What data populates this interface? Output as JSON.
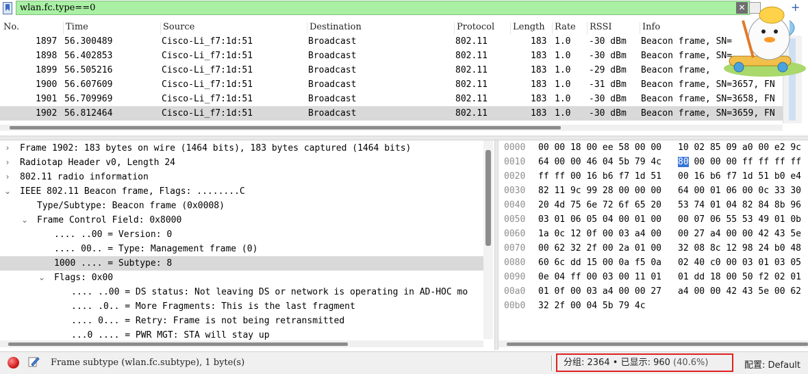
{
  "filter": {
    "value": "wlan.fc.type==0",
    "clear_icon": "✕"
  },
  "packet_list": {
    "columns": [
      "No.",
      "Time",
      "Source",
      "Destination",
      "Protocol",
      "Length",
      "Rate",
      "RSSI",
      "Info"
    ],
    "rows": [
      {
        "no": "1897",
        "time": "56.300489",
        "source": "Cisco-Li_f7:1d:51",
        "destination": "Broadcast",
        "protocol": "802.11",
        "length": "183",
        "rate": "1.0",
        "rssi": "-30 dBm",
        "info": "Beacon frame, SN="
      },
      {
        "no": "1898",
        "time": "56.402853",
        "source": "Cisco-Li_f7:1d:51",
        "destination": "Broadcast",
        "protocol": "802.11",
        "length": "183",
        "rate": "1.0",
        "rssi": "-30 dBm",
        "info": "Beacon frame, SN="
      },
      {
        "no": "1899",
        "time": "56.505216",
        "source": "Cisco-Li_f7:1d:51",
        "destination": "Broadcast",
        "protocol": "802.11",
        "length": "183",
        "rate": "1.0",
        "rssi": "-29 dBm",
        "info": "Beacon frame,"
      },
      {
        "no": "1900",
        "time": "56.607609",
        "source": "Cisco-Li_f7:1d:51",
        "destination": "Broadcast",
        "protocol": "802.11",
        "length": "183",
        "rate": "1.0",
        "rssi": "-31 dBm",
        "info": "Beacon frame, SN=3657, FN"
      },
      {
        "no": "1901",
        "time": "56.709969",
        "source": "Cisco-Li_f7:1d:51",
        "destination": "Broadcast",
        "protocol": "802.11",
        "length": "183",
        "rate": "1.0",
        "rssi": "-30 dBm",
        "info": "Beacon frame, SN=3658, FN"
      },
      {
        "no": "1902",
        "time": "56.812464",
        "source": "Cisco-Li_f7:1d:51",
        "destination": "Broadcast",
        "protocol": "802.11",
        "length": "183",
        "rate": "1.0",
        "rssi": "-30 dBm",
        "info": "Beacon frame, SN=3659, FN"
      }
    ],
    "selected_index": 5
  },
  "details": [
    {
      "text": "Frame 1902: 183 bytes on wire (1464 bits), 183 bytes captured (1464 bits)",
      "arrow": "›",
      "level": 0,
      "sel": false
    },
    {
      "text": "Radiotap Header v0, Length 24",
      "arrow": "›",
      "level": 0,
      "sel": false
    },
    {
      "text": "802.11 radio information",
      "arrow": "›",
      "level": 0,
      "sel": false
    },
    {
      "text": "IEEE 802.11 Beacon frame, Flags: ........C",
      "arrow": "⌄",
      "level": 0,
      "sel": false
    },
    {
      "text": "Type/Subtype: Beacon frame (0x0008)",
      "arrow": "",
      "level": 1,
      "sel": false
    },
    {
      "text": "Frame Control Field: 0x8000",
      "arrow": "⌄",
      "level": 1,
      "sel": false
    },
    {
      "text": ".... ..00 = Version: 0",
      "arrow": "",
      "level": 2,
      "sel": false
    },
    {
      "text": ".... 00.. = Type: Management frame (0)",
      "arrow": "",
      "level": 2,
      "sel": false
    },
    {
      "text": "1000 .... = Subtype: 8",
      "arrow": "",
      "level": 2,
      "sel": true
    },
    {
      "text": "Flags: 0x00",
      "arrow": "⌄",
      "level": 2,
      "sel": false
    },
    {
      "text": ".... ..00 = DS status: Not leaving DS or network is operating in AD-HOC mo",
      "arrow": "",
      "level": 3,
      "sel": false
    },
    {
      "text": ".... .0.. = More Fragments: This is the last fragment",
      "arrow": "",
      "level": 3,
      "sel": false
    },
    {
      "text": ".... 0... = Retry: Frame is not being retransmitted",
      "arrow": "",
      "level": 3,
      "sel": false
    },
    {
      "text": "...0 .... = PWR MGT: STA will stay up",
      "arrow": "",
      "level": 3,
      "sel": false
    }
  ],
  "hex": [
    {
      "offset": "0000",
      "b1": "00 00 18 00 ee 58 00 00",
      "b2": "10 02 85 09 a0 00 e2 9c"
    },
    {
      "offset": "0010",
      "b1": "64 00 00 46 04 5b 79 4c",
      "b2_hl": "80",
      "b2": " 00 00 00 ff ff ff ff"
    },
    {
      "offset": "0020",
      "b1": "ff ff 00 16 b6 f7 1d 51",
      "b2": "00 16 b6 f7 1d 51 b0 e4"
    },
    {
      "offset": "0030",
      "b1": "82 11 9c 99 28 00 00 00",
      "b2": "64 00 01 06 00 0c 33 30"
    },
    {
      "offset": "0040",
      "b1": "20 4d 75 6e 72 6f 65 20",
      "b2": "53 74 01 04 82 84 8b 96"
    },
    {
      "offset": "0050",
      "b1": "03 01 06 05 04 00 01 00",
      "b2": "00 07 06 55 53 49 01 0b"
    },
    {
      "offset": "0060",
      "b1": "1a 0c 12 0f 00 03 a4 00",
      "b2": "00 27 a4 00 00 42 43 5e"
    },
    {
      "offset": "0070",
      "b1": "00 62 32 2f 00 2a 01 00",
      "b2": "32 08 8c 12 98 24 b0 48"
    },
    {
      "offset": "0080",
      "b1": "60 6c dd 15 00 0a f5 0a",
      "b2": "02 40 c0 00 03 01 03 05"
    },
    {
      "offset": "0090",
      "b1": "0e 04 ff 00 03 00 11 01",
      "b2": "01 dd 18 00 50 f2 02 01"
    },
    {
      "offset": "00a0",
      "b1": "01 0f 00 03 a4 00 00 27",
      "b2": "a4 00 00 42 43 5e 00 62"
    },
    {
      "offset": "00b0",
      "b1": "32 2f 00 04 5b 79 4c",
      "b2": ""
    }
  ],
  "status": {
    "field_info": "Frame subtype (wlan.fc.subtype), 1 byte(s)",
    "packets_label": "分组: 2364",
    "bullet": "•",
    "displayed_label": "已显示: 960",
    "displayed_pct": "(40.6%)",
    "profile": "配置: Default"
  },
  "colors": {
    "filter_ok": "#a9f0a4",
    "selection": "#d9d9d9",
    "hex_highlight": "#3875d7",
    "counts_box": "#e02020"
  }
}
